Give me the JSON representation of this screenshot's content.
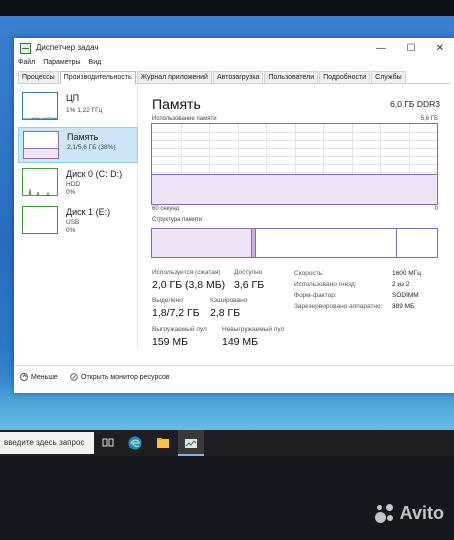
{
  "window": {
    "title": "Диспетчер задач",
    "controls": {
      "minimize": "—",
      "maximize": "☐",
      "close": "✕"
    }
  },
  "menu": [
    "Файл",
    "Параметры",
    "Вид"
  ],
  "tabs": [
    "Процессы",
    "Производительность",
    "Журнал приложений",
    "Автозагрузка",
    "Пользователи",
    "Подробности",
    "Службы"
  ],
  "active_tab_index": 1,
  "resources": [
    {
      "name": "ЦП",
      "line1": "1% 1,22 ГГц",
      "line2": "",
      "line3": ""
    },
    {
      "name": "Память",
      "line1": "2,1/5,6 ГБ (38%)",
      "line2": "",
      "line3": ""
    },
    {
      "name": "Диск 0 (C: D:)",
      "line1": "HDD",
      "line2": "0%",
      "line3": ""
    },
    {
      "name": "Диск 1 (E:)",
      "line1": "USB",
      "line2": "0%",
      "line3": ""
    }
  ],
  "selected_resource_index": 1,
  "memory": {
    "title": "Память",
    "spec": "6,0 ГБ DDR3",
    "usage_label": "Использование памяти",
    "usage_max": "5,6 ГБ",
    "time_span": "60 секунд",
    "time_end": "0",
    "usage_fraction": 0.38,
    "composition_label": "Структура памяти",
    "stats": {
      "in_use_label": "Используется (сжатая)",
      "in_use_value": "2,0 ГБ (3,8 МБ)",
      "available_label": "Доступно",
      "available_value": "3,6 ГБ",
      "committed_label": "Выделено",
      "committed_value": "1,8/7,2 ГБ",
      "cached_label": "Кэшировано",
      "cached_value": "2,8 ГБ",
      "paged_label": "Выгружаемый пул",
      "paged_value": "159 МБ",
      "nonpaged_label": "Невыгружаемый пул",
      "nonpaged_value": "149 МБ"
    },
    "details": [
      {
        "key": "Скорость:",
        "value": "1600 МГц"
      },
      {
        "key": "Использовано гнезд:",
        "value": "2 из 2"
      },
      {
        "key": "Форм-фактор:",
        "value": "SODIMM"
      },
      {
        "key": "Зарезервировано аппаратно:",
        "value": "389 МБ"
      }
    ]
  },
  "footer": {
    "less_label": "Меньше",
    "monitor_label": "Открыть монитор ресурсов"
  },
  "taskbar": {
    "search_placeholder": "введите здесь запрос"
  },
  "watermark": "Avito",
  "colors": {
    "memory_accent": "#8b6aa8",
    "cpu_accent": "#3a7ab8",
    "disk_accent": "#4a9a3a",
    "selected_bg": "#cce6f7"
  }
}
